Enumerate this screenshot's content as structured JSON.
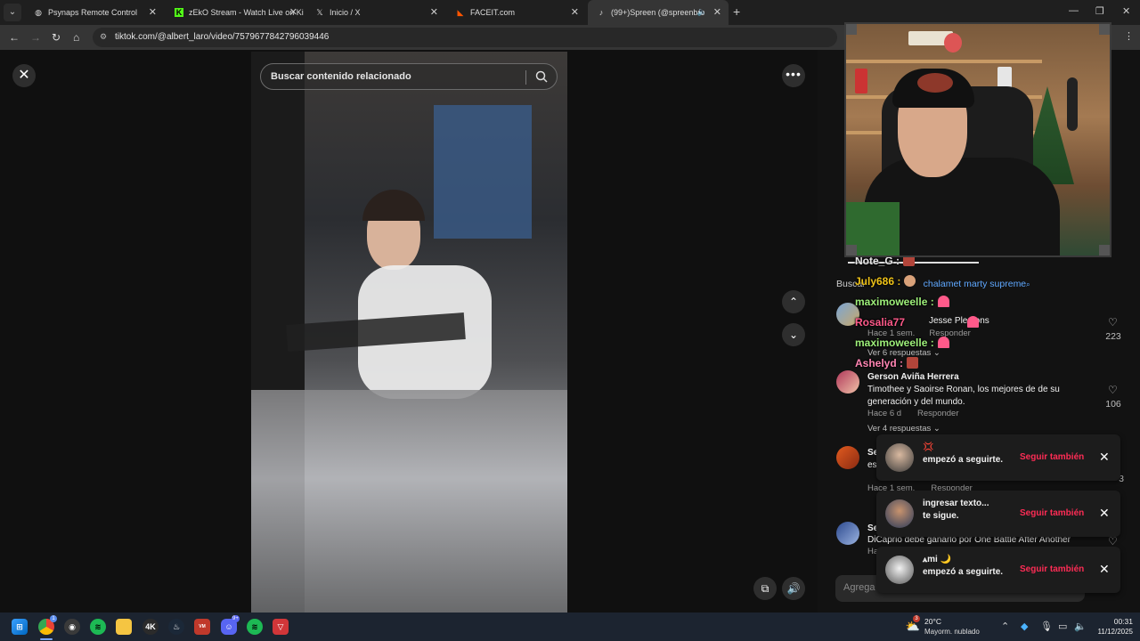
{
  "browser": {
    "tabs": [
      {
        "title": "Psynaps Remote Control",
        "favicon": "globe-icon"
      },
      {
        "title": "zEkO Stream - Watch Live on Ki",
        "favicon": "kick-icon"
      },
      {
        "title": "Inicio / X",
        "favicon": "x-icon"
      },
      {
        "title": "FACEIT.com",
        "favicon": "faceit-icon"
      },
      {
        "title": "(99+)Spreen (@spreenbro",
        "favicon": "tiktok-icon",
        "active": true
      }
    ],
    "url": "tiktok.com/@albert_laro/video/7579677842796039446"
  },
  "tiktok": {
    "search_placeholder": "Buscar contenido relacionado",
    "related_search_prefix": "Buscar",
    "related_search": "chalamet marty supreme",
    "comments": [
      {
        "text": "Jesse Plemons",
        "time": "Hace 1 sem.",
        "reply": "Responder",
        "likes": "223",
        "view_replies": "Ver 6 respuestas"
      },
      {
        "name": "Gerson Aviña Herrera",
        "text": "Timothee y Saoirse Ronan, los mejores de de su generación y del mundo.",
        "time": "Hace 6 d",
        "reply": "Responder",
        "likes": "106",
        "view_replies": "Ver 4 respuestas"
      },
      {
        "name": "Se",
        "text": "es",
        "time": "Hace 1 sem.",
        "reply": "Responder",
        "likes": "3"
      },
      {
        "name": "Se",
        "text": "DiCaprio debe ganarlo por One Battle After Another",
        "time": "Ha"
      }
    ],
    "comment_placeholder": "Agrega"
  },
  "stream_chat": [
    {
      "user": "Note_G",
      "color": "#e8e8e8"
    },
    {
      "user": "July686",
      "color": "#f0c419"
    },
    {
      "user": "maximoweelle",
      "color": "#9ef07a"
    },
    {
      "user": "Rosalia77",
      "color": "#ff5a8a"
    },
    {
      "user": "maximoweelle",
      "color": "#9ef07a"
    },
    {
      "user": "Ashelyd",
      "color": "#ff85b3"
    }
  ],
  "notifications": [
    {
      "name": "💢",
      "text": "empezó a seguirte.",
      "action": "Seguir también"
    },
    {
      "name": "ingresar texto...",
      "text": "te sigue.",
      "action": "Seguir también"
    },
    {
      "name": "ꭺmi 🌙",
      "text": "empezó a seguirte.",
      "action": "Seguir también"
    }
  ],
  "taskbar": {
    "weather_temp": "20°C",
    "weather_desc": "Mayorm. nublado",
    "time": "00:31",
    "date": "11/12/2025",
    "apps": [
      {
        "name": "start-icon",
        "color": "#00a4ef"
      },
      {
        "name": "chrome-icon",
        "color": "#ea4335"
      },
      {
        "name": "obs-icon",
        "color": "#3a3a3a"
      },
      {
        "name": "spotify-icon",
        "color": "#1db954"
      },
      {
        "name": "file-explorer-icon",
        "color": "#f5c542"
      },
      {
        "name": "4k-icon",
        "color": "#2b2b2b"
      },
      {
        "name": "steam-icon",
        "color": "#1b2838"
      },
      {
        "name": "voicemeeter-icon",
        "color": "#c0392b"
      },
      {
        "name": "discord-icon",
        "color": "#5865f2"
      },
      {
        "name": "spotify-icon",
        "color": "#1db954"
      },
      {
        "name": "vanguard-icon",
        "color": "#d13639"
      }
    ],
    "badges": {
      "chrome": "1",
      "discord": "9+",
      "weather": "3"
    }
  },
  "colors": {
    "accent": "#fe2c55",
    "tab_bg": "#1f1f1f",
    "toolbar_bg": "#353535",
    "taskbar_bg": "#1c2430"
  }
}
